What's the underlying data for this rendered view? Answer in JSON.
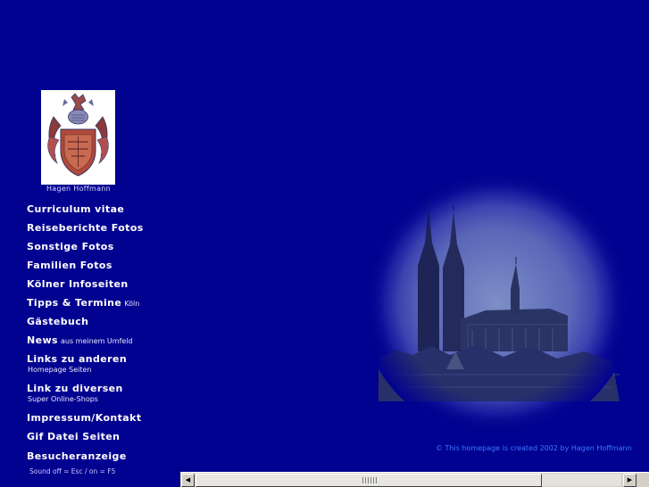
{
  "crest": {
    "caption": "Hagen Hoffmann"
  },
  "menu": [
    {
      "label": "Curriculum vitae",
      "sub": "",
      "sub2": ""
    },
    {
      "label": "Reiseberichte Fotos",
      "sub": "",
      "sub2": ""
    },
    {
      "label": "Sonstige Fotos",
      "sub": "",
      "sub2": ""
    },
    {
      "label": "Familien Fotos",
      "sub": "",
      "sub2": ""
    },
    {
      "label": "Kölner Infoseiten",
      "sub": "",
      "sub2": ""
    },
    {
      "label": "Tipps & Termine",
      "sub": "Köln",
      "sub2": ""
    },
    {
      "label": "Gästebuch",
      "sub": "",
      "sub2": ""
    },
    {
      "label": "News",
      "sub": "aus meinem Umfeld",
      "sub2": ""
    },
    {
      "label": "Links zu anderen",
      "sub": "",
      "sub2": "Homepage Seiten"
    },
    {
      "label": "Link zu diversen",
      "sub": "",
      "sub2": "Super Online-Shops"
    },
    {
      "label": "Impressum/Kontakt",
      "sub": "",
      "sub2": ""
    },
    {
      "label": "Gif Datei Seiten",
      "sub": "",
      "sub2": ""
    },
    {
      "label": "Besucheranzeige",
      "sub": "",
      "sub2": ""
    }
  ],
  "sound_note": "Sound off = Esc / on = F5",
  "copyright": "© This homepage is created 2002 by Hagen Hoffmann",
  "scrollbar": {
    "left_arrow": "◀",
    "right_arrow": "▶"
  }
}
